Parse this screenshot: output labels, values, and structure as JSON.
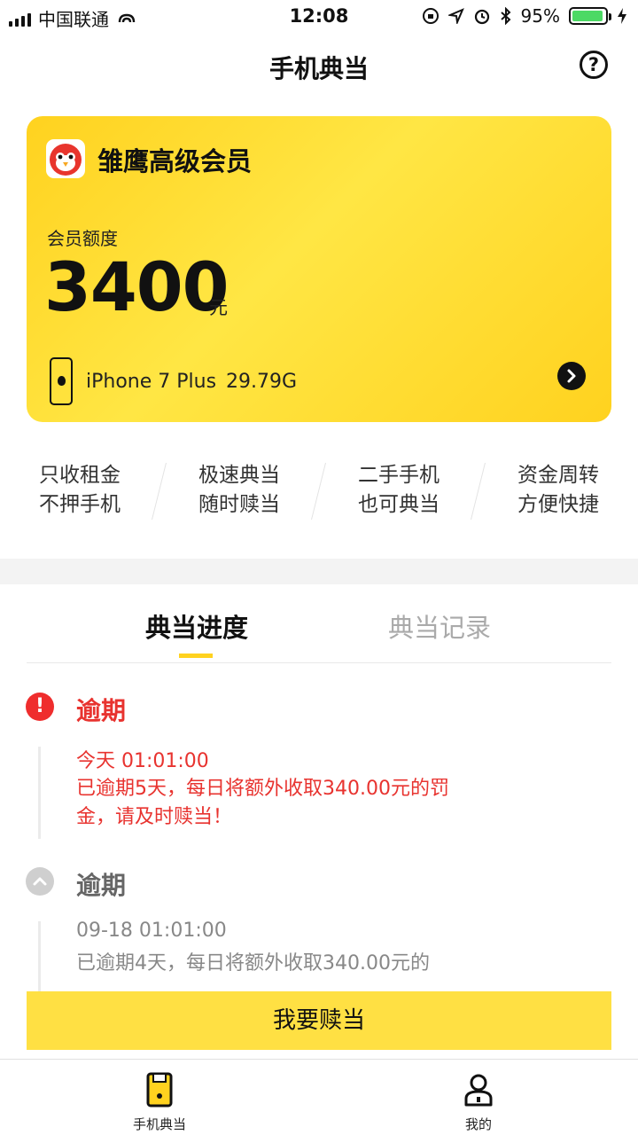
{
  "status_bar": {
    "carrier": "中国联通",
    "time": "12:08",
    "battery": "95%"
  },
  "header": {
    "title": "手机典当",
    "help_symbol": "?"
  },
  "card": {
    "title": "雏鹰高级会员",
    "quota_label": "会员额度",
    "quota_value": "3400",
    "quota_unit": "元",
    "device_model": "iPhone 7 Plus",
    "device_storage": "29.79G"
  },
  "features": [
    {
      "line1": "只收租金",
      "line2": "不押手机"
    },
    {
      "line1": "极速典当",
      "line2": "随时赎当"
    },
    {
      "line1": "二手手机",
      "line2": "也可典当"
    },
    {
      "line1": "资金周转",
      "line2": "方便快捷"
    }
  ],
  "tabs": {
    "active": "典当进度",
    "inactive": "典当记录"
  },
  "timeline": [
    {
      "status": "逾期",
      "time": "今天 01:01:00",
      "message": "已逾期5天，每日将额外收取340.00元的罚金，请及时赎当！",
      "state": "alert"
    },
    {
      "status": "逾期",
      "time": "09-18 01:01:00",
      "message": "已逾期4天，每日将额外收取340.00元的",
      "state": "past"
    }
  ],
  "action": {
    "redeem_label": "我要赎当"
  },
  "bottom_nav": [
    {
      "label": "手机典当",
      "icon": "phone-pawn-icon"
    },
    {
      "label": "我的",
      "icon": "profile-icon"
    }
  ],
  "colors": {
    "brand_yellow": "#ffd21f",
    "alert_red": "#e8332f"
  }
}
